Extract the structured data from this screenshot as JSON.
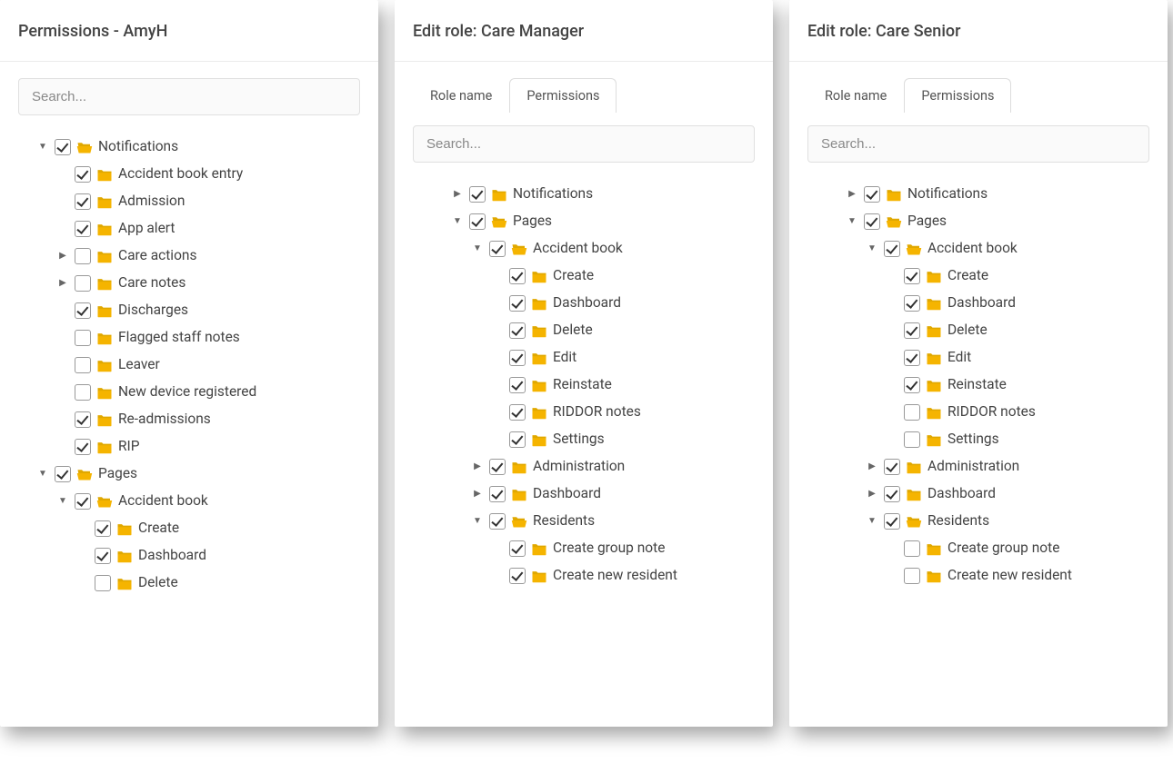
{
  "search_placeholder": "Search...",
  "panels": [
    {
      "title": "Permissions - AmyH",
      "has_tabs": false,
      "tree": [
        {
          "depth": 0,
          "caret": "down",
          "checked": true,
          "folder": "open",
          "label": "Notifications"
        },
        {
          "depth": 1,
          "caret": "none",
          "checked": true,
          "folder": "closed",
          "label": "Accident book entry"
        },
        {
          "depth": 1,
          "caret": "none",
          "checked": true,
          "folder": "closed",
          "label": "Admission"
        },
        {
          "depth": 1,
          "caret": "none",
          "checked": true,
          "folder": "closed",
          "label": "App alert"
        },
        {
          "depth": 1,
          "caret": "right",
          "checked": false,
          "folder": "closed",
          "label": "Care actions"
        },
        {
          "depth": 1,
          "caret": "right",
          "checked": false,
          "folder": "closed",
          "label": "Care notes"
        },
        {
          "depth": 1,
          "caret": "none",
          "checked": true,
          "folder": "closed",
          "label": "Discharges"
        },
        {
          "depth": 1,
          "caret": "none",
          "checked": false,
          "folder": "closed",
          "label": "Flagged staff notes"
        },
        {
          "depth": 1,
          "caret": "none",
          "checked": false,
          "folder": "closed",
          "label": "Leaver"
        },
        {
          "depth": 1,
          "caret": "none",
          "checked": false,
          "folder": "closed",
          "label": "New device registered"
        },
        {
          "depth": 1,
          "caret": "none",
          "checked": true,
          "folder": "closed",
          "label": "Re-admissions"
        },
        {
          "depth": 1,
          "caret": "none",
          "checked": true,
          "folder": "closed",
          "label": "RIP"
        },
        {
          "depth": 0,
          "caret": "down",
          "checked": true,
          "folder": "open",
          "label": "Pages"
        },
        {
          "depth": 1,
          "caret": "down",
          "checked": true,
          "folder": "open",
          "label": "Accident book"
        },
        {
          "depth": 2,
          "caret": "none",
          "checked": true,
          "folder": "closed",
          "label": "Create"
        },
        {
          "depth": 2,
          "caret": "none",
          "checked": true,
          "folder": "closed",
          "label": "Dashboard"
        },
        {
          "depth": 2,
          "caret": "none",
          "checked": false,
          "folder": "closed",
          "label": "Delete"
        }
      ]
    },
    {
      "title": "Edit role: Care Manager",
      "has_tabs": true,
      "tabs": [
        {
          "label": "Role name",
          "active": false
        },
        {
          "label": "Permissions",
          "active": true
        }
      ],
      "tree": [
        {
          "depth": 1,
          "caret": "right",
          "checked": true,
          "folder": "closed",
          "label": "Notifications"
        },
        {
          "depth": 1,
          "caret": "down",
          "checked": true,
          "folder": "open",
          "label": "Pages"
        },
        {
          "depth": 2,
          "caret": "down",
          "checked": true,
          "folder": "open",
          "label": "Accident book"
        },
        {
          "depth": 3,
          "caret": "none",
          "checked": true,
          "folder": "closed",
          "label": "Create"
        },
        {
          "depth": 3,
          "caret": "none",
          "checked": true,
          "folder": "closed",
          "label": "Dashboard"
        },
        {
          "depth": 3,
          "caret": "none",
          "checked": true,
          "folder": "closed",
          "label": "Delete"
        },
        {
          "depth": 3,
          "caret": "none",
          "checked": true,
          "folder": "closed",
          "label": "Edit"
        },
        {
          "depth": 3,
          "caret": "none",
          "checked": true,
          "folder": "closed",
          "label": "Reinstate"
        },
        {
          "depth": 3,
          "caret": "none",
          "checked": true,
          "folder": "closed",
          "label": "RIDDOR notes"
        },
        {
          "depth": 3,
          "caret": "none",
          "checked": true,
          "folder": "closed",
          "label": "Settings"
        },
        {
          "depth": 2,
          "caret": "right",
          "checked": true,
          "folder": "closed",
          "label": "Administration"
        },
        {
          "depth": 2,
          "caret": "right",
          "checked": true,
          "folder": "closed",
          "label": "Dashboard"
        },
        {
          "depth": 2,
          "caret": "down",
          "checked": true,
          "folder": "open",
          "label": "Residents"
        },
        {
          "depth": 3,
          "caret": "none",
          "checked": true,
          "folder": "closed",
          "label": "Create group note"
        },
        {
          "depth": 3,
          "caret": "none",
          "checked": true,
          "folder": "closed",
          "label": "Create new resident"
        }
      ]
    },
    {
      "title": "Edit role: Care Senior",
      "has_tabs": true,
      "tabs": [
        {
          "label": "Role name",
          "active": false
        },
        {
          "label": "Permissions",
          "active": true
        }
      ],
      "tree": [
        {
          "depth": 1,
          "caret": "right",
          "checked": true,
          "folder": "closed",
          "label": "Notifications"
        },
        {
          "depth": 1,
          "caret": "down",
          "checked": true,
          "folder": "open",
          "label": "Pages"
        },
        {
          "depth": 2,
          "caret": "down",
          "checked": true,
          "folder": "open",
          "label": "Accident book"
        },
        {
          "depth": 3,
          "caret": "none",
          "checked": true,
          "folder": "closed",
          "label": "Create"
        },
        {
          "depth": 3,
          "caret": "none",
          "checked": true,
          "folder": "closed",
          "label": "Dashboard"
        },
        {
          "depth": 3,
          "caret": "none",
          "checked": true,
          "folder": "closed",
          "label": "Delete"
        },
        {
          "depth": 3,
          "caret": "none",
          "checked": true,
          "folder": "closed",
          "label": "Edit"
        },
        {
          "depth": 3,
          "caret": "none",
          "checked": true,
          "folder": "closed",
          "label": "Reinstate"
        },
        {
          "depth": 3,
          "caret": "none",
          "checked": false,
          "folder": "closed",
          "label": "RIDDOR notes"
        },
        {
          "depth": 3,
          "caret": "none",
          "checked": false,
          "folder": "closed",
          "label": "Settings"
        },
        {
          "depth": 2,
          "caret": "right",
          "checked": true,
          "folder": "closed",
          "label": "Administration"
        },
        {
          "depth": 2,
          "caret": "right",
          "checked": true,
          "folder": "closed",
          "label": "Dashboard"
        },
        {
          "depth": 2,
          "caret": "down",
          "checked": true,
          "folder": "open",
          "label": "Residents"
        },
        {
          "depth": 3,
          "caret": "none",
          "checked": false,
          "folder": "closed",
          "label": "Create group note"
        },
        {
          "depth": 3,
          "caret": "none",
          "checked": false,
          "folder": "closed",
          "label": "Create new resident"
        }
      ]
    }
  ]
}
